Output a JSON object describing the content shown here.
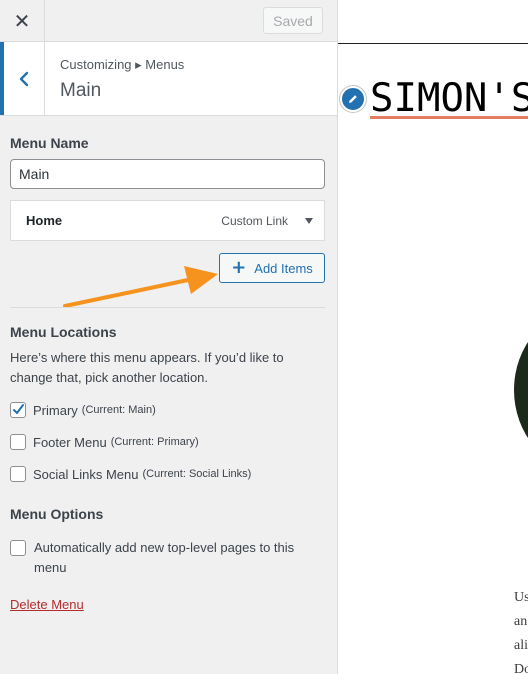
{
  "topbar": {
    "close_icon": "close-icon",
    "saved_label": "Saved"
  },
  "section": {
    "breadcrumb": "Customizing ▸ Menus",
    "title": "Main",
    "back_icon": "chevron-left-icon",
    "accent_color": "#2271b1"
  },
  "menu_name": {
    "label": "Menu Name",
    "value": "Main"
  },
  "menu_items": [
    {
      "title": "Home",
      "type": "Custom Link",
      "toggle_icon": "triangle-down-icon"
    }
  ],
  "add_items": {
    "label": "Add Items",
    "icon": "plus-icon"
  },
  "annotation_arrow": {
    "icon": "arrow-icon",
    "color": "#f5931e"
  },
  "menu_locations": {
    "label": "Menu Locations",
    "description": "Here’s where this menu appears. If you’d like to change that, pick another location.",
    "items": [
      {
        "name": "Primary",
        "current": "(Current: Main)",
        "checked": true
      },
      {
        "name": "Footer Menu",
        "current": "(Current: Primary)",
        "checked": false
      },
      {
        "name": "Social Links Menu",
        "current": "(Current: Social Links)",
        "checked": false
      }
    ]
  },
  "menu_options": {
    "label": "Menu Options",
    "auto_add_label": "Automatically add new top-level pages to this menu",
    "auto_add_checked": false
  },
  "delete_menu_label": "Delete Menu",
  "preview": {
    "site_title": "SIMON'S",
    "edit_icon": "pencil-icon",
    "underline_color": "#e47d61",
    "text_fragments": [
      "Us",
      "an",
      "ali",
      "Do"
    ]
  }
}
